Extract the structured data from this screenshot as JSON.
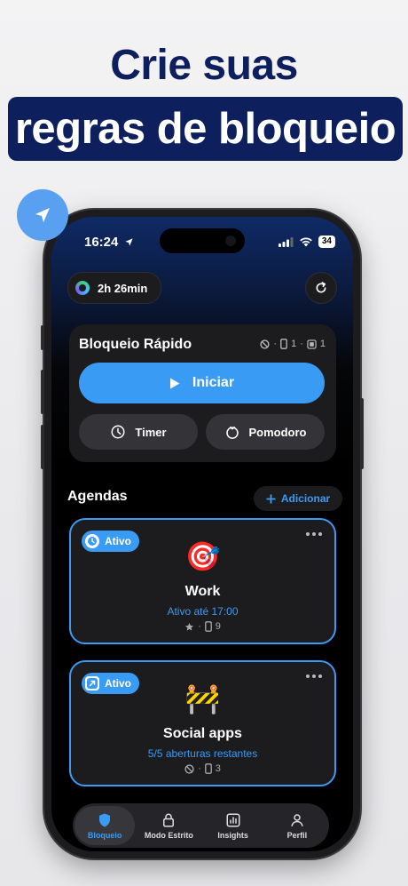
{
  "promo": {
    "line1": "Crie suas",
    "line2": "regras de bloqueio"
  },
  "status_bar": {
    "time": "16:24",
    "battery": "34"
  },
  "timer_pill": {
    "label": "2h 26min"
  },
  "quick_block": {
    "title": "Bloqueio Rápido",
    "apps_count": "1",
    "categories_count": "1",
    "start_label": "Iniciar",
    "timer_label": "Timer",
    "pomodoro_label": "Pomodoro"
  },
  "schedules": {
    "title": "Agendas",
    "add_label": "Adicionar",
    "items": [
      {
        "badge": "Ativo",
        "emoji": "🎯",
        "name": "Work",
        "subtitle": "Ativo até 17:00",
        "apps_count": "9"
      },
      {
        "badge": "Ativo",
        "emoji": "🚧",
        "name": "Social apps",
        "subtitle": "5/5 aberturas restantes",
        "apps_count": "3"
      }
    ]
  },
  "tabbar": {
    "items": [
      {
        "label": "Bloqueio",
        "icon": "shield-icon",
        "active": true
      },
      {
        "label": "Modo Estrito",
        "icon": "lock-icon",
        "active": false
      },
      {
        "label": "Insights",
        "icon": "chart-icon",
        "active": false
      },
      {
        "label": "Perfil",
        "icon": "person-icon",
        "active": false
      }
    ]
  },
  "colors": {
    "accent": "#3a9bf5",
    "headline": "#0d1f5c",
    "card": "#1c1c1e"
  }
}
